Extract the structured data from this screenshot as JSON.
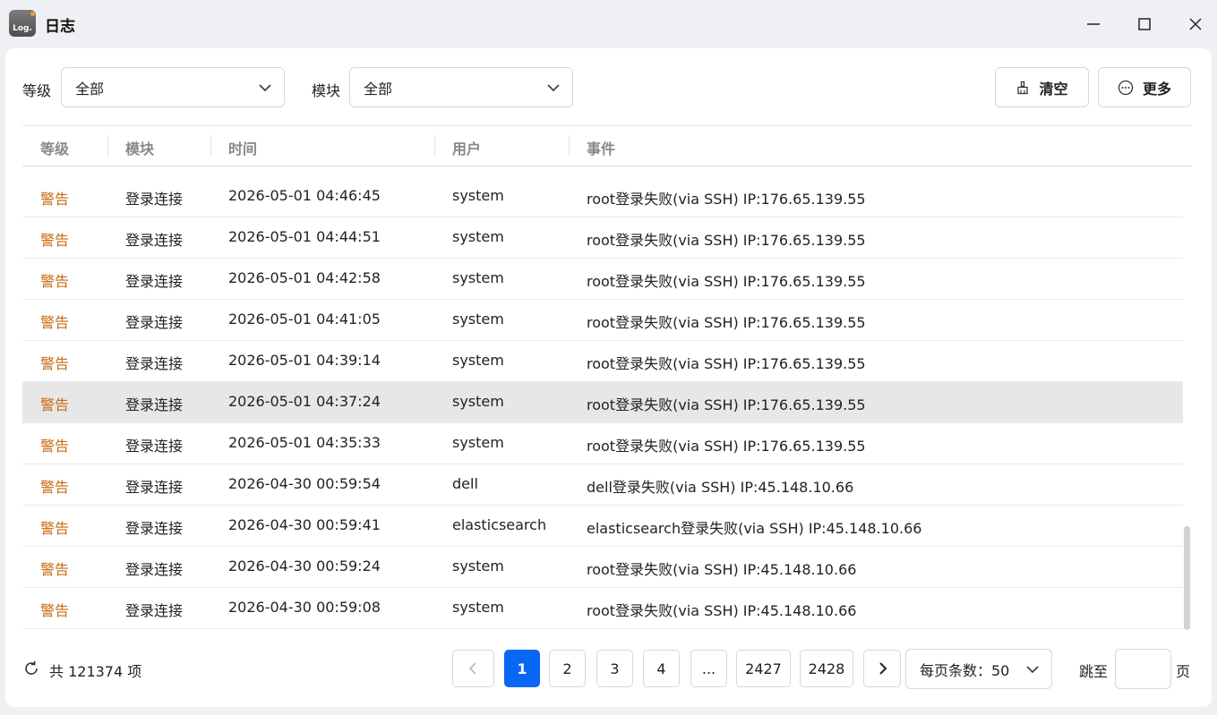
{
  "window": {
    "title": "日志",
    "icon_text": "Log."
  },
  "filters": {
    "level_label": "等级",
    "level_value": "全部",
    "module_label": "模块",
    "module_value": "全部"
  },
  "actions": {
    "clear_label": "清空",
    "more_label": "更多"
  },
  "table": {
    "columns": [
      "等级",
      "模块",
      "时间",
      "用户",
      "事件"
    ],
    "rows": [
      {
        "level": "警告",
        "module": "登录连接",
        "time": "2026-05-01 04:46:45",
        "user": "system",
        "event": "root登录失败(via SSH) IP:176.65.139.55"
      },
      {
        "level": "警告",
        "module": "登录连接",
        "time": "2026-05-01 04:44:51",
        "user": "system",
        "event": "root登录失败(via SSH) IP:176.65.139.55"
      },
      {
        "level": "警告",
        "module": "登录连接",
        "time": "2026-05-01 04:42:58",
        "user": "system",
        "event": "root登录失败(via SSH) IP:176.65.139.55"
      },
      {
        "level": "警告",
        "module": "登录连接",
        "time": "2026-05-01 04:41:05",
        "user": "system",
        "event": "root登录失败(via SSH) IP:176.65.139.55"
      },
      {
        "level": "警告",
        "module": "登录连接",
        "time": "2026-05-01 04:39:14",
        "user": "system",
        "event": "root登录失败(via SSH) IP:176.65.139.55"
      },
      {
        "level": "警告",
        "module": "登录连接",
        "time": "2026-05-01 04:37:24",
        "user": "system",
        "event": "root登录失败(via SSH) IP:176.65.139.55",
        "highlighted": true
      },
      {
        "level": "警告",
        "module": "登录连接",
        "time": "2026-05-01 04:35:33",
        "user": "system",
        "event": "root登录失败(via SSH) IP:176.65.139.55"
      },
      {
        "level": "警告",
        "module": "登录连接",
        "time": "2026-04-30 00:59:54",
        "user": "dell",
        "event": "dell登录失败(via SSH) IP:45.148.10.66"
      },
      {
        "level": "警告",
        "module": "登录连接",
        "time": "2026-04-30 00:59:41",
        "user": "elasticsearch",
        "event": "elasticsearch登录失败(via SSH) IP:45.148.10.66"
      },
      {
        "level": "警告",
        "module": "登录连接",
        "time": "2026-04-30 00:59:24",
        "user": "system",
        "event": "root登录失败(via SSH) IP:45.148.10.66"
      },
      {
        "level": "警告",
        "module": "登录连接",
        "time": "2026-04-30 00:59:08",
        "user": "system",
        "event": "root登录失败(via SSH) IP:45.148.10.66"
      }
    ]
  },
  "footer": {
    "total_text": "共 121374 项",
    "pages": [
      "1",
      "2",
      "3",
      "4",
      "...",
      "2427",
      "2428"
    ],
    "current_page": "1",
    "page_size_text": "每页条数：50",
    "jump_label": "跳至",
    "jump_suffix": "页"
  },
  "colors": {
    "accent": "#0a66f5",
    "warning": "#c86a12",
    "row_highlight": "#e7e7e7"
  }
}
